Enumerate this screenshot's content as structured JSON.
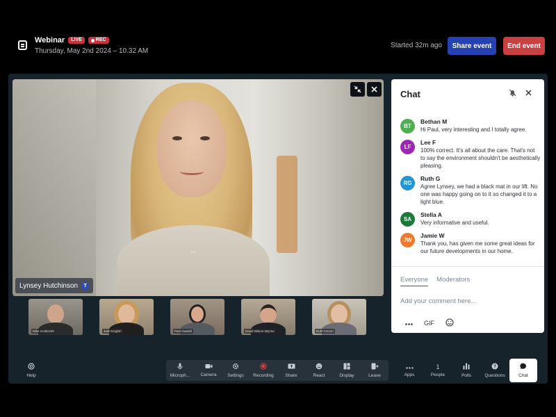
{
  "header": {
    "title": "Webinar",
    "live_badge": "LIVE",
    "rec_badge": "REC",
    "subtitle": "Thursday, May 2nd 2024 – 10.32 AM",
    "started": "Started 32m ago",
    "share_label": "Share event",
    "end_label": "End event"
  },
  "main_video": {
    "speaker_name": "Lynsey Hutchinson",
    "speaker_badge": "T"
  },
  "thumbnails": [
    {
      "name": "Mike Goldsmith"
    },
    {
      "name": "Jade English"
    },
    {
      "name": "Paul Gaskell"
    },
    {
      "name": "David Wilson-Wynne"
    },
    {
      "name": "Ruth French"
    }
  ],
  "chat": {
    "title": "Chat",
    "messages": [
      {
        "initials": "BT",
        "color": "#4caf50",
        "name": "Bethan M",
        "text": "Hi Paul, very interesting and I totally agree."
      },
      {
        "initials": "LF",
        "color": "#9c27b0",
        "name": "Lee F",
        "text": "100% correct. It's all about the care. That's not to say the environment shouldn't be aesthetically pleasing."
      },
      {
        "initials": "RG",
        "color": "#2196d3",
        "name": "Ruth G",
        "text": "Agree Lynsey, we had a black mat in our lift. No one was happy going on to it so changed it to a light blue."
      },
      {
        "initials": "SA",
        "color": "#1b7a3a",
        "name": "Stella A",
        "text": "Very informative and useful."
      },
      {
        "initials": "JW",
        "color": "#f07a2a",
        "name": "Jamie W",
        "text": "Thank you, has given me some great ideas for our future developments in our home."
      }
    ],
    "tab_everyone": "Everyone",
    "tab_moderators": "Moderators",
    "placeholder": "Add your comment here...",
    "gif_label": "GIF"
  },
  "toolbar": {
    "help": "Help",
    "microphone": "Microph...",
    "camera": "Camera",
    "settings": "Settings",
    "recording": "Recording",
    "share": "Share",
    "react": "React",
    "display": "Display",
    "leave": "Leave",
    "apps": "Apps",
    "people_count": "1",
    "people": "People",
    "polls": "Polls",
    "questions": "Questions",
    "chat": "Chat"
  }
}
